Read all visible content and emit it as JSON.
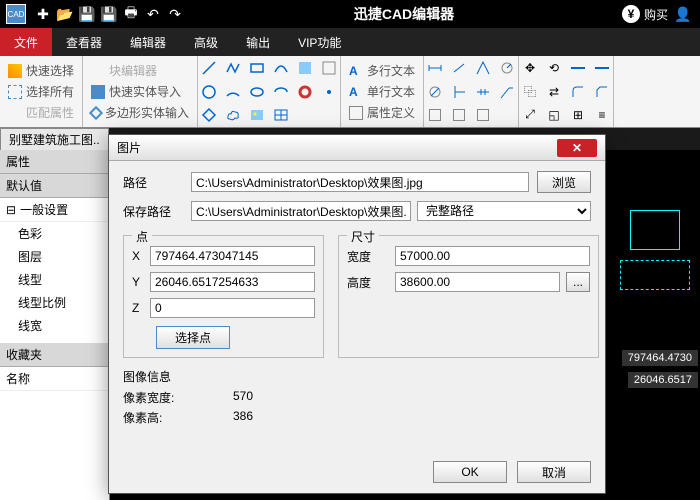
{
  "titlebar": {
    "app_title": "迅捷CAD编辑器",
    "buy": "购买"
  },
  "menubar": {
    "tabs": [
      "文件",
      "查看器",
      "编辑器",
      "高级",
      "输出",
      "VIP功能"
    ],
    "active_index": 0
  },
  "ribbon": {
    "group1": {
      "quick_select": "快速选择",
      "select_all": "选择所有",
      "match_props": "匹配属性",
      "block_editor": "块编辑器",
      "fast_entity_import": "快速实体导入",
      "poly_entity_input": "多边形实体输入"
    },
    "group3": {
      "mtext": "多行文本",
      "stext": "单行文本",
      "attdef": "属性定义"
    }
  },
  "doctab": "别墅建筑施工图..",
  "left_panel": {
    "headers": {
      "props": "属性",
      "defaults": "默认值",
      "favorites": "收藏夹"
    },
    "general": "一般设置",
    "rows": [
      "色彩",
      "图层",
      "线型",
      "线型比例",
      "线宽"
    ],
    "name": "名称"
  },
  "canvas": {
    "coord1": "797464.4730",
    "coord2": "26046.6517"
  },
  "dialog": {
    "title": "图片",
    "path_label": "路径",
    "path_value": "C:\\Users\\Administrator\\Desktop\\效果图.jpg",
    "browse": "浏览",
    "save_path_label": "保存路径",
    "save_path_value": "C:\\Users\\Administrator\\Desktop\\效果图.jp",
    "save_mode": "完整路径",
    "point_group": "点",
    "x_label": "X",
    "x_value": "797464.473047145",
    "y_label": "Y",
    "y_value": "26046.6517254633",
    "z_label": "Z",
    "z_value": "0",
    "select_point": "选择点",
    "size_group": "尺寸",
    "width_label": "宽度",
    "width_value": "57000.00",
    "height_label": "高度",
    "height_value": "38600.00",
    "info_title": "图像信息",
    "px_width_label": "像素宽度:",
    "px_width_value": "570",
    "px_height_label": "像素高:",
    "px_height_value": "386",
    "ok": "OK",
    "cancel": "取消"
  }
}
